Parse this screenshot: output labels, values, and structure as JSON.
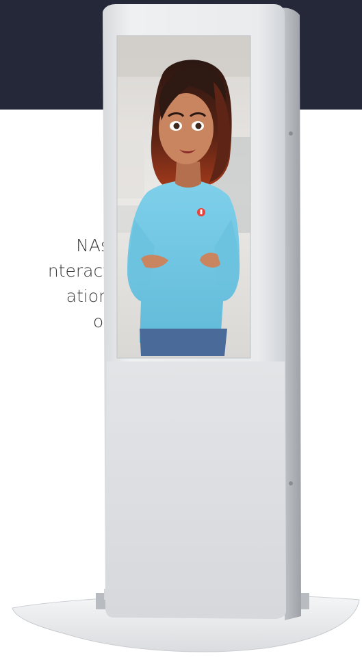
{
  "header": {
    "background_color": "#252839"
  },
  "body_text": {
    "lines": [
      "NAs",
      "nteract",
      "ation",
      "of"
    ]
  },
  "kiosk": {
    "name": "digital-human-kiosk",
    "screen_content": "avatar-woman-blue-sweater",
    "frame_color": "#e6e7e9"
  }
}
